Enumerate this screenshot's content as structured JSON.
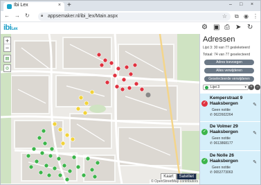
{
  "browser": {
    "tab_title": "Ibi Lex",
    "url": "appsemaker.nl/ibi_lex/Main.aspx",
    "new_tab": "+",
    "tab_close": "×",
    "window_controls": [
      "–",
      "□",
      "×"
    ],
    "nav": [
      "←",
      "→",
      "↻"
    ],
    "icons": [
      "lock-icon",
      "star-icon",
      "extensions-icon",
      "profile-icon",
      "menu-icon"
    ]
  },
  "app": {
    "logo_main": "ibi",
    "logo_sub": "Lex",
    "header_icons": [
      "gear-icon",
      "contacts-icon",
      "print-icon",
      "send-icon",
      "refresh-icon"
    ]
  },
  "map": {
    "zoom_in": "+",
    "zoom_out": "−",
    "map_types": [
      "Kaart",
      "Satelliet"
    ],
    "active_type": "Satelliet",
    "attribution": "© OpenStreetMap contributors",
    "markers": {
      "red": 16,
      "yellow": 10,
      "green": 26
    }
  },
  "panel": {
    "title": "Adressen",
    "lijst_status": "Lijst 3: 30 van 77 gesleketeerd",
    "totaal_status": "Totaal: 74 van 77 geselecteerd",
    "buttons": [
      "Adres toevoegen",
      "Alles verwijderen",
      "Geselecteerde verwijderen"
    ],
    "select_value": "Lijst 3",
    "add_button": "+",
    "remove_button": "−",
    "addresses": [
      {
        "street": "Kemperstraat 9",
        "city": "Haaksbergen",
        "note": "Geen notitie",
        "phone": "0622602264",
        "status": "red"
      },
      {
        "street": "De Volmer 29",
        "city": "Haaksbergen",
        "note": "Geen notitie",
        "phone": "0613868177",
        "status": "green"
      },
      {
        "street": "De Nolle 26",
        "city": "Haaksbergen",
        "note": "Geen notitie",
        "phone": "0653773063",
        "status": "green"
      }
    ]
  },
  "colors": {
    "accent": "#1a9dc6",
    "marker_red": "#e0323f",
    "marker_yellow": "#f2d33a",
    "marker_green": "#3cb54a",
    "list_bg": "#d6effa"
  }
}
